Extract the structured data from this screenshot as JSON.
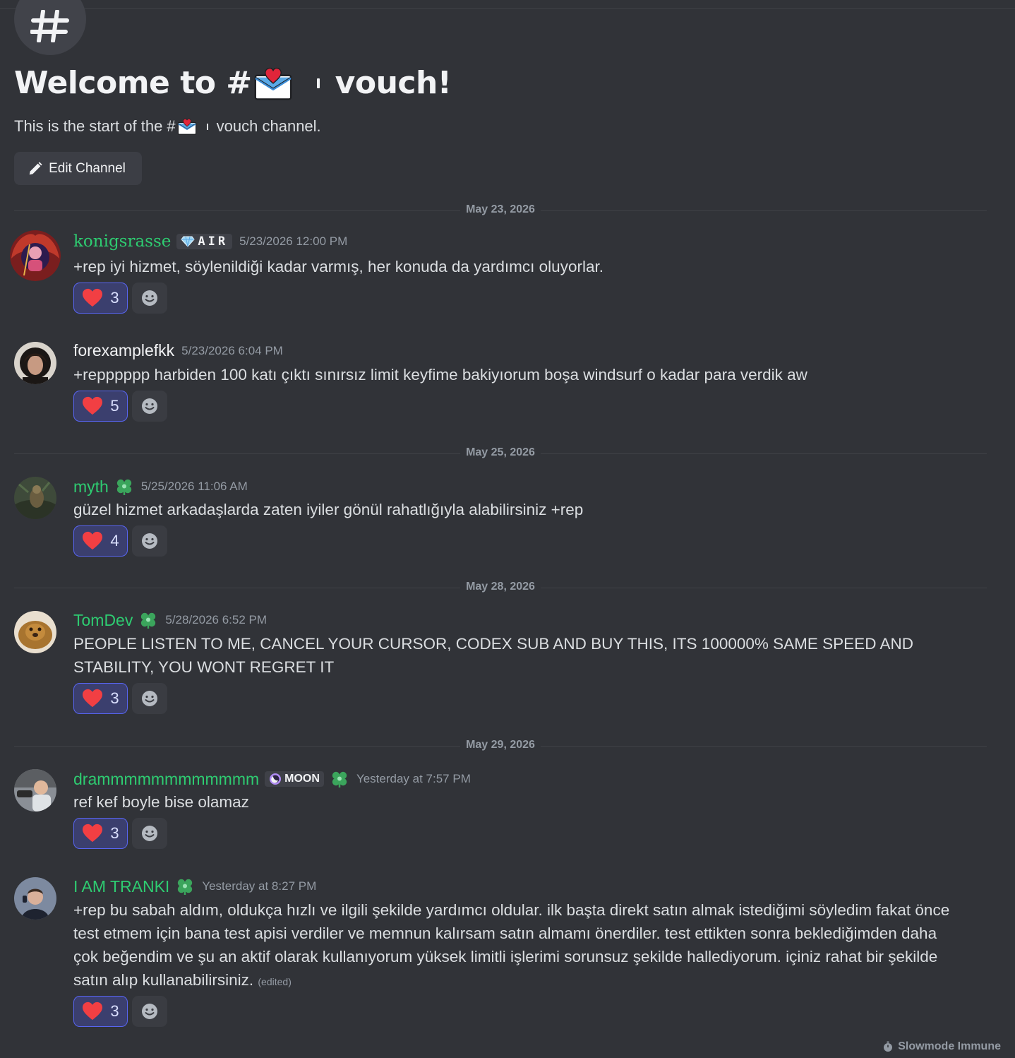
{
  "channel": {
    "welcome_prefix": "Welcome to #",
    "welcome_suffix": "vouch!",
    "start_prefix": "This is the start of the #",
    "start_suffix": "vouch channel.",
    "edit_label": "Edit Channel"
  },
  "dividers": [
    "May 23, 2026",
    "May 25, 2026",
    "May 28, 2026",
    "May 29, 2026"
  ],
  "messages": [
    {
      "username": "konigsrasse",
      "tag": "AIR",
      "timestamp": "5/23/2026 12:00 PM",
      "text": "+rep iyi hizmet, söylenildiği kadar varmış, her konuda da yardımcı oluyorlar.",
      "reaction_count": "3"
    },
    {
      "username": "forexamplefkk",
      "timestamp": "5/23/2026 6:04 PM",
      "text": "+repppppp harbiden 100 katı çıktı sınırsız limit keyfime bakiyıorum boşa windsurf o kadar para verdik aw",
      "reaction_count": "5"
    },
    {
      "username": "myth",
      "timestamp": "5/25/2026 11:06 AM",
      "text": "güzel hizmet  arkadaşlarda zaten iyiler gönül rahatlığıyla alabilirsiniz +rep",
      "reaction_count": "4"
    },
    {
      "username": "TomDev",
      "timestamp": "5/28/2026 6:52 PM",
      "text": "PEOPLE LISTEN TO ME, CANCEL YOUR CURSOR, CODEX SUB AND BUY THIS, ITS 100000% SAME SPEED AND STABILITY, YOU WONT REGRET IT",
      "reaction_count": "3"
    },
    {
      "username": "drammmmmmmmmmmm",
      "tag": "MOON",
      "timestamp": "Yesterday at 7:57 PM",
      "text": "ref kef boyle bise olamaz",
      "reaction_count": "3"
    },
    {
      "username": "I AM TRANKI",
      "timestamp": "Yesterday at 8:27 PM",
      "text": "+rep bu sabah aldım, oldukça hızlı ve ilgili şekilde yardımcı oldular. ilk başta direkt satın almak istediğimi söyledim fakat önce test etmem için bana test apisi verdiler ve memnun kalırsam satın almamı önerdiler. test ettikten sonra beklediğimden daha çok beğendim ve şu an aktif olarak kullanıyorum yüksek limitli işlerimi sorunsuz şekilde hallediyorum. içiniz rahat bir şekilde satın alıp kullanabilirsiniz.",
      "edited": "(edited)",
      "reaction_count": "3"
    }
  ],
  "footer": {
    "slowmode": "Slowmode Immune"
  },
  "colors": {
    "background": "#313338",
    "accent": "#5865f2",
    "username_green": "#2ecc71",
    "heart": "#f23f43"
  },
  "icons": [
    "hash-icon",
    "envelope-heart-icon",
    "pencil-icon",
    "heart-icon",
    "add-reaction-icon",
    "diamond-icon",
    "moon-icon",
    "clover-icon",
    "stopwatch-icon"
  ]
}
